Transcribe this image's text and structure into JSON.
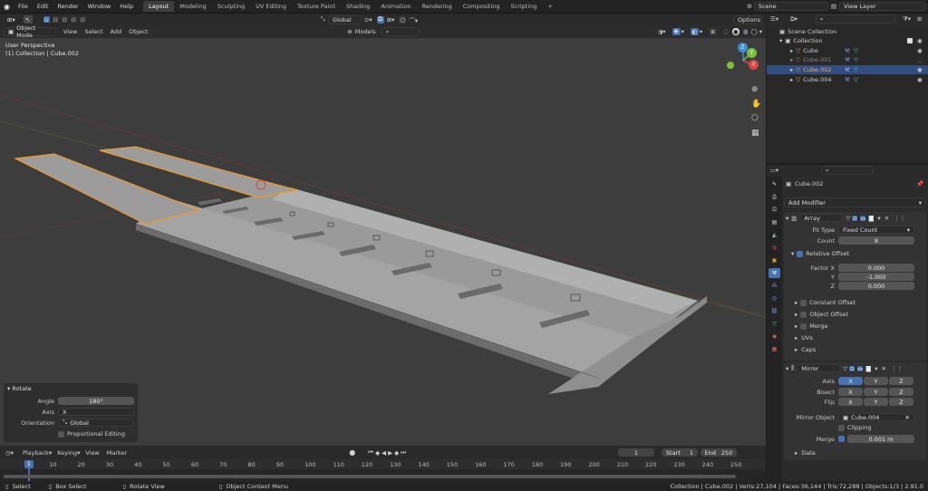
{
  "topbar": {
    "menus": [
      "File",
      "Edit",
      "Render",
      "Window",
      "Help"
    ],
    "workspaces": [
      "Layout",
      "Modeling",
      "Sculpting",
      "UV Editing",
      "Texture Paint",
      "Shading",
      "Animation",
      "Rendering",
      "Compositing",
      "Scripting"
    ],
    "active_workspace": "Layout",
    "add_label": "+",
    "scene": "Scene",
    "view_layer": "View Layer"
  },
  "viewport_header": {
    "transform_orientation": "Global",
    "options_label": "Options",
    "mode": "Object Mode",
    "menus": [
      "View",
      "Select",
      "Add",
      "Object"
    ],
    "models_label": "Models"
  },
  "viewport": {
    "perspective_label": "User Perspective",
    "collection_label": "(1) Collection | Cube.002",
    "axis_x": "X",
    "axis_y": "Y",
    "axis_z": "Z"
  },
  "rotate_panel": {
    "title": "Rotate",
    "angle_label": "Angle",
    "angle_value": "180°",
    "axis_label": "Axis",
    "axis_value": "X",
    "orientation_label": "Orientation",
    "orientation_value": "Global",
    "proportional_label": "Proportional Editing"
  },
  "outliner": {
    "items": [
      {
        "name": "Scene Collection"
      },
      {
        "name": "Collection"
      },
      {
        "name": "Cube"
      },
      {
        "name": "Cube.001"
      },
      {
        "name": "Cube.002"
      },
      {
        "name": "Cube.004"
      }
    ]
  },
  "properties": {
    "object_name": "Cube.002",
    "add_modifier_label": "Add Modifier",
    "array": {
      "name": "Array",
      "fit_type_label": "Fit Type",
      "fit_type_value": "Fixed Count",
      "count_label": "Count",
      "count_value": "8",
      "relative_offset_label": "Relative Offset",
      "factor_x_label": "Factor X",
      "factor_x_value": "0.000",
      "y_label": "Y",
      "y_value": "-1.000",
      "z_label": "Z",
      "z_value": "0.000",
      "constant_offset_label": "Constant Offset",
      "object_offset_label": "Object Offset",
      "merge_label": "Merge",
      "uvs_label": "UVs",
      "caps_label": "Caps"
    },
    "mirror": {
      "name": "Mirror",
      "axis_label": "Axis",
      "bisect_label": "Bisect",
      "flip_label": "Flip",
      "x": "X",
      "y": "Y",
      "z": "Z",
      "mirror_object_label": "Mirror Object",
      "mirror_object_value": "Cube.004",
      "clipping_label": "Clipping",
      "merge_label": "Merge",
      "merge_value": "0.001 m",
      "data_label": "Data"
    }
  },
  "timeline": {
    "menus": [
      "Playback",
      "Keying",
      "View",
      "Marker"
    ],
    "current_frame": "1",
    "start_label": "Start",
    "start_value": "1",
    "end_label": "End",
    "end_value": "250",
    "ticks": [
      "1",
      "10",
      "20",
      "30",
      "40",
      "50",
      "60",
      "70",
      "80",
      "90",
      "100",
      "110",
      "120",
      "130",
      "140",
      "150",
      "160",
      "170",
      "180",
      "190",
      "200",
      "210",
      "220",
      "230",
      "240",
      "250"
    ]
  },
  "statusbar": {
    "select": "Select",
    "box_select": "Box Select",
    "rotate_view": "Rotate View",
    "context_menu": "Object Context Menu",
    "stats": "Collection | Cube.002 | Verts:27,104 | Faces:36,144 | Tris:72,288 | Objects:1/3 | 2.91.0"
  },
  "colors": {
    "accent": "#4772b3",
    "selection_outline": "#f39a2b",
    "mesh_light": "#9c9c9c",
    "mesh_dark": "#7a7a7a"
  }
}
